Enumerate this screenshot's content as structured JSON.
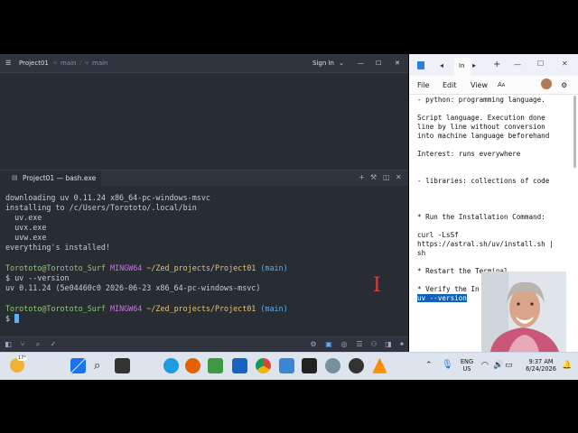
{
  "zed": {
    "project": "Project01",
    "branch1": "main",
    "branch2": "main",
    "sign_in": "Sign In",
    "terminal_tab": "Project01 — bash.exe",
    "terminal_lines": [
      "downloading uv 0.11.24 x86_64-pc-windows-msvc",
      "installing to /c/Users/Torototo/.local/bin",
      "  uv.exe",
      "  uvx.exe",
      "  uvw.exe",
      "everything's installed!"
    ],
    "prompt_user": "Torototo@Torototo_Surf",
    "prompt_shell": "MINGW64",
    "prompt_path": "~/Zed_projects/Project01",
    "prompt_branch": "(main)",
    "cmd1": "$ uv --version",
    "output1": "uv 0.11.24 (5e04460c0 2026-06-23 x86_64-pc-windows-msvc)",
    "prompt_end": "$ "
  },
  "notepad": {
    "tab_label": "In",
    "menu": [
      "File",
      "Edit",
      "View"
    ],
    "lines": [
      "- python: programming language.",
      "",
      "Script language. Execution done",
      "line by line without conversion",
      "into machine language beforehand",
      "",
      "Interest: runs everywhere",
      "",
      "",
      "- libraries: collections of code",
      "",
      "",
      "",
      "* Run the Installation Command:",
      "",
      "curl -LsSf",
      "https://astral.sh/uv/install.sh |",
      "sh",
      "",
      "* Restart the Terminal",
      "",
      "* Verify the In"
    ],
    "selected_line": "uv --version"
  },
  "taskbar": {
    "weather": "17°",
    "lang1": "ENG",
    "lang2": "US",
    "time": "9:37 AM",
    "date": "6/24/2026"
  }
}
